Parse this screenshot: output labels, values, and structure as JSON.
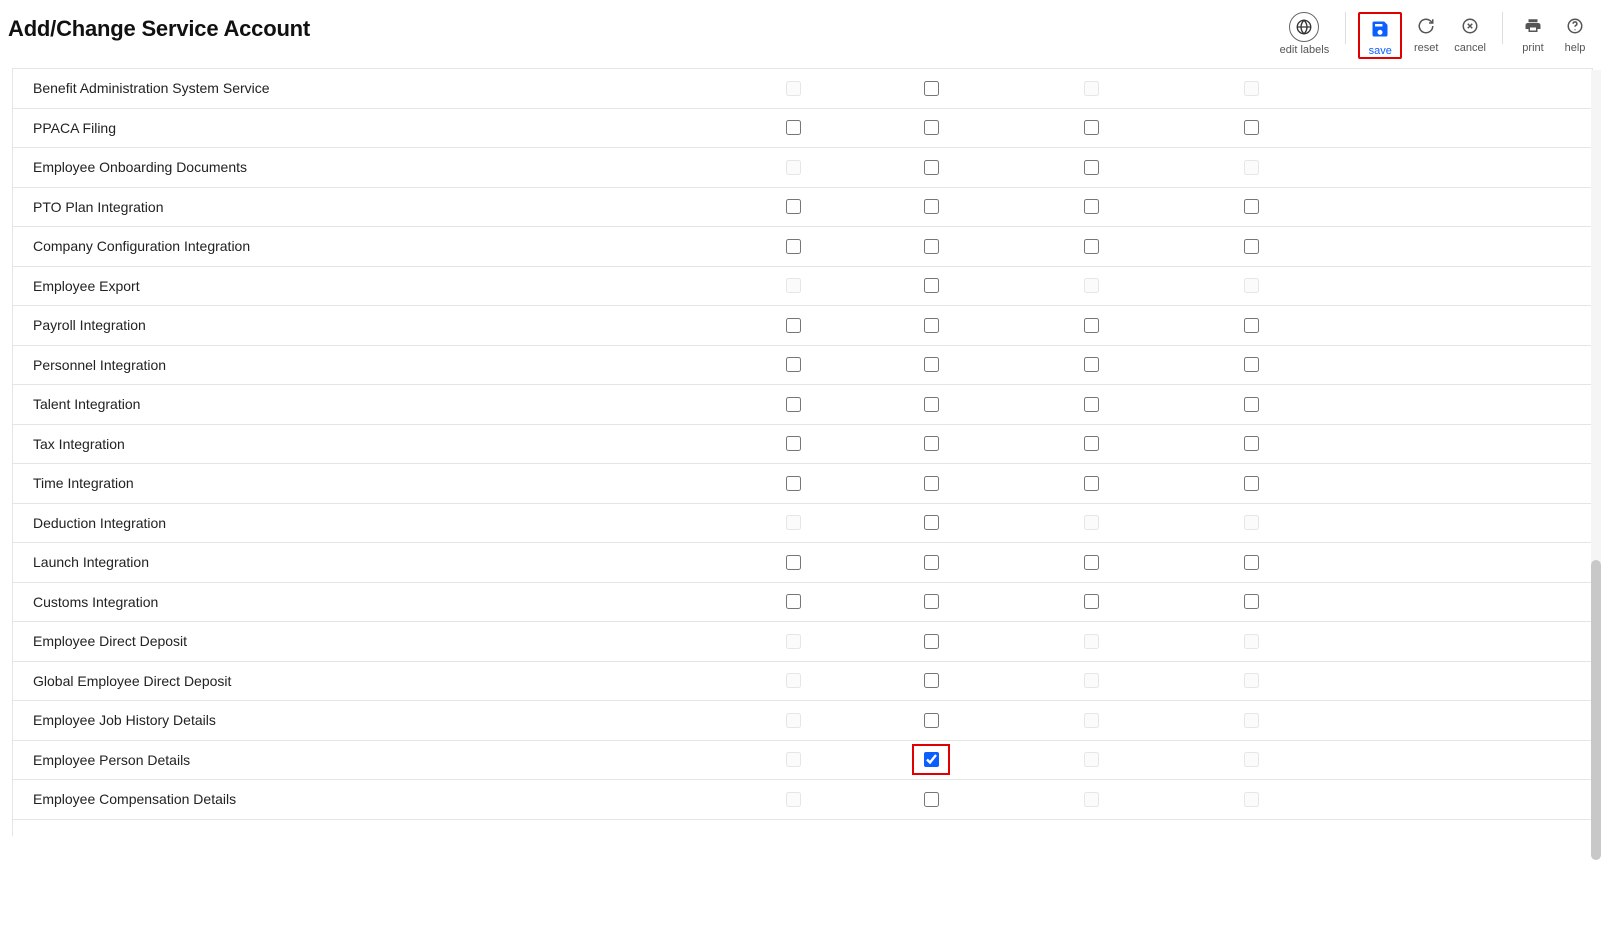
{
  "header": {
    "title": "Add/Change Service Account"
  },
  "toolbar": {
    "edit_labels": "edit labels",
    "save": "save",
    "reset": "reset",
    "cancel": "cancel",
    "print": "print",
    "help": "help"
  },
  "rows": [
    {
      "label": "Benefit Administration System Service",
      "c1": {
        "checked": false,
        "enabled": false
      },
      "c2": {
        "checked": false,
        "enabled": true
      },
      "c3": {
        "checked": false,
        "enabled": false
      },
      "c4": {
        "checked": false,
        "enabled": false
      }
    },
    {
      "label": "PPACA Filing",
      "c1": {
        "checked": false,
        "enabled": true
      },
      "c2": {
        "checked": false,
        "enabled": true
      },
      "c3": {
        "checked": false,
        "enabled": true
      },
      "c4": {
        "checked": false,
        "enabled": true
      }
    },
    {
      "label": "Employee Onboarding Documents",
      "c1": {
        "checked": false,
        "enabled": false
      },
      "c2": {
        "checked": false,
        "enabled": true
      },
      "c3": {
        "checked": false,
        "enabled": true
      },
      "c4": {
        "checked": false,
        "enabled": false
      }
    },
    {
      "label": "PTO Plan Integration",
      "c1": {
        "checked": false,
        "enabled": true
      },
      "c2": {
        "checked": false,
        "enabled": true
      },
      "c3": {
        "checked": false,
        "enabled": true
      },
      "c4": {
        "checked": false,
        "enabled": true
      }
    },
    {
      "label": "Company Configuration Integration",
      "c1": {
        "checked": false,
        "enabled": true
      },
      "c2": {
        "checked": false,
        "enabled": true
      },
      "c3": {
        "checked": false,
        "enabled": true
      },
      "c4": {
        "checked": false,
        "enabled": true
      }
    },
    {
      "label": "Employee Export",
      "c1": {
        "checked": false,
        "enabled": false
      },
      "c2": {
        "checked": false,
        "enabled": true
      },
      "c3": {
        "checked": false,
        "enabled": false
      },
      "c4": {
        "checked": false,
        "enabled": false
      }
    },
    {
      "label": "Payroll Integration",
      "c1": {
        "checked": false,
        "enabled": true
      },
      "c2": {
        "checked": false,
        "enabled": true
      },
      "c3": {
        "checked": false,
        "enabled": true
      },
      "c4": {
        "checked": false,
        "enabled": true
      }
    },
    {
      "label": "Personnel Integration",
      "c1": {
        "checked": false,
        "enabled": true
      },
      "c2": {
        "checked": false,
        "enabled": true
      },
      "c3": {
        "checked": false,
        "enabled": true
      },
      "c4": {
        "checked": false,
        "enabled": true
      }
    },
    {
      "label": "Talent Integration",
      "c1": {
        "checked": false,
        "enabled": true
      },
      "c2": {
        "checked": false,
        "enabled": true
      },
      "c3": {
        "checked": false,
        "enabled": true
      },
      "c4": {
        "checked": false,
        "enabled": true
      }
    },
    {
      "label": "Tax Integration",
      "c1": {
        "checked": false,
        "enabled": true
      },
      "c2": {
        "checked": false,
        "enabled": true
      },
      "c3": {
        "checked": false,
        "enabled": true
      },
      "c4": {
        "checked": false,
        "enabled": true
      }
    },
    {
      "label": "Time Integration",
      "c1": {
        "checked": false,
        "enabled": true
      },
      "c2": {
        "checked": false,
        "enabled": true
      },
      "c3": {
        "checked": false,
        "enabled": true
      },
      "c4": {
        "checked": false,
        "enabled": true
      }
    },
    {
      "label": "Deduction Integration",
      "c1": {
        "checked": false,
        "enabled": false
      },
      "c2": {
        "checked": false,
        "enabled": true
      },
      "c3": {
        "checked": false,
        "enabled": false
      },
      "c4": {
        "checked": false,
        "enabled": false
      }
    },
    {
      "label": "Launch Integration",
      "c1": {
        "checked": false,
        "enabled": true
      },
      "c2": {
        "checked": false,
        "enabled": true
      },
      "c3": {
        "checked": false,
        "enabled": true
      },
      "c4": {
        "checked": false,
        "enabled": true
      }
    },
    {
      "label": "Customs Integration",
      "c1": {
        "checked": false,
        "enabled": true
      },
      "c2": {
        "checked": false,
        "enabled": true
      },
      "c3": {
        "checked": false,
        "enabled": true
      },
      "c4": {
        "checked": false,
        "enabled": true
      }
    },
    {
      "label": "Employee Direct Deposit",
      "c1": {
        "checked": false,
        "enabled": false
      },
      "c2": {
        "checked": false,
        "enabled": true
      },
      "c3": {
        "checked": false,
        "enabled": false
      },
      "c4": {
        "checked": false,
        "enabled": false
      }
    },
    {
      "label": "Global Employee Direct Deposit",
      "c1": {
        "checked": false,
        "enabled": false
      },
      "c2": {
        "checked": false,
        "enabled": true
      },
      "c3": {
        "checked": false,
        "enabled": false
      },
      "c4": {
        "checked": false,
        "enabled": false
      }
    },
    {
      "label": "Employee Job History Details",
      "c1": {
        "checked": false,
        "enabled": false
      },
      "c2": {
        "checked": false,
        "enabled": true
      },
      "c3": {
        "checked": false,
        "enabled": false
      },
      "c4": {
        "checked": false,
        "enabled": false
      }
    },
    {
      "label": "Employee Person Details",
      "c1": {
        "checked": false,
        "enabled": false
      },
      "c2": {
        "checked": true,
        "enabled": true,
        "highlight": true
      },
      "c3": {
        "checked": false,
        "enabled": false
      },
      "c4": {
        "checked": false,
        "enabled": false
      }
    },
    {
      "label": "Employee Compensation Details",
      "c1": {
        "checked": false,
        "enabled": false
      },
      "c2": {
        "checked": false,
        "enabled": true
      },
      "c3": {
        "checked": false,
        "enabled": false
      },
      "c4": {
        "checked": false,
        "enabled": false
      }
    }
  ]
}
